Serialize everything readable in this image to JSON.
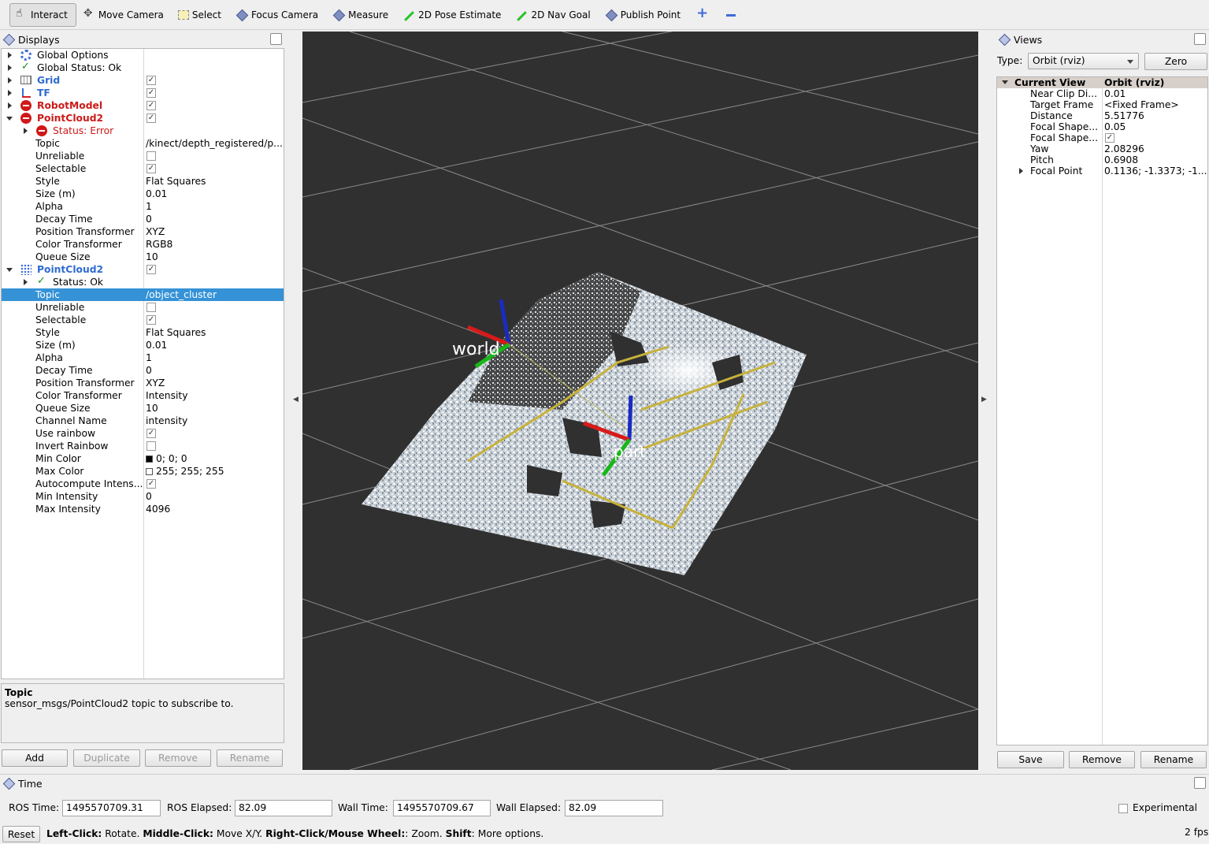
{
  "toolbar": {
    "interact": "Interact",
    "move_camera": "Move Camera",
    "select": "Select",
    "focus_camera": "Focus Camera",
    "measure": "Measure",
    "pose_estimate": "2D Pose Estimate",
    "nav_goal": "2D Nav Goal",
    "publish_point": "Publish Point"
  },
  "displays": {
    "title": "Displays",
    "rows": {
      "global_options": "Global Options",
      "global_status": "Global Status: Ok",
      "grid": "Grid",
      "tf": "TF",
      "robot_model": "RobotModel",
      "pc1": "PointCloud2",
      "pc1_status": "Status: Error",
      "pc2": "PointCloud2",
      "pc2_status": "Status: Ok"
    },
    "pc1_props": [
      {
        "k": "Topic",
        "v": "/kinect/depth_registered/p..."
      },
      {
        "k": "Unreliable",
        "v": ""
      },
      {
        "k": "Selectable",
        "v": ""
      },
      {
        "k": "Style",
        "v": "Flat Squares"
      },
      {
        "k": "Size (m)",
        "v": "0.01"
      },
      {
        "k": "Alpha",
        "v": "1"
      },
      {
        "k": "Decay Time",
        "v": "0"
      },
      {
        "k": "Position Transformer",
        "v": "XYZ"
      },
      {
        "k": "Color Transformer",
        "v": "RGB8"
      },
      {
        "k": "Queue Size",
        "v": "10"
      }
    ],
    "pc2_props": [
      {
        "k": "Topic",
        "v": "/object_cluster"
      },
      {
        "k": "Unreliable",
        "v": ""
      },
      {
        "k": "Selectable",
        "v": ""
      },
      {
        "k": "Style",
        "v": "Flat Squares"
      },
      {
        "k": "Size (m)",
        "v": "0.01"
      },
      {
        "k": "Alpha",
        "v": "1"
      },
      {
        "k": "Decay Time",
        "v": "0"
      },
      {
        "k": "Position Transformer",
        "v": "XYZ"
      },
      {
        "k": "Color Transformer",
        "v": "Intensity"
      },
      {
        "k": "Queue Size",
        "v": "10"
      },
      {
        "k": "Channel Name",
        "v": "intensity"
      },
      {
        "k": "Use rainbow",
        "v": ""
      },
      {
        "k": "Invert Rainbow",
        "v": ""
      },
      {
        "k": "Min Color",
        "v": "0; 0; 0"
      },
      {
        "k": "Max Color",
        "v": "255; 255; 255"
      },
      {
        "k": "Autocompute Intens...",
        "v": ""
      },
      {
        "k": "Min Intensity",
        "v": "0"
      },
      {
        "k": "Max Intensity",
        "v": "4096"
      }
    ],
    "desc_title": "Topic",
    "desc_text": "sensor_msgs/PointCloud2 topic to subscribe to.",
    "add": "Add",
    "duplicate": "Duplicate",
    "remove": "Remove",
    "rename": "Rename"
  },
  "scene": {
    "frame_world": "world",
    "frame_part": "part"
  },
  "views": {
    "title": "Views",
    "type_label": "Type:",
    "type_value": "Orbit (rviz)",
    "zero": "Zero",
    "header_k": "Current View",
    "header_v": "Orbit (rviz)",
    "props": [
      {
        "k": "Near Clip Di...",
        "v": "0.01"
      },
      {
        "k": "Target Frame",
        "v": "<Fixed Frame>"
      },
      {
        "k": "Distance",
        "v": "5.51776"
      },
      {
        "k": "Focal Shape...",
        "v": "0.05"
      },
      {
        "k": "Focal Shape...",
        "v": ""
      },
      {
        "k": "Yaw",
        "v": "2.08296"
      },
      {
        "k": "Pitch",
        "v": "0.6908"
      },
      {
        "k": "Focal Point",
        "v": "0.1136; -1.3373; -1..."
      }
    ],
    "save": "Save",
    "remove": "Remove",
    "rename": "Rename"
  },
  "time": {
    "title": "Time",
    "ros_time_label": "ROS Time:",
    "ros_time": "1495570709.31",
    "ros_elapsed_label": "ROS Elapsed:",
    "ros_elapsed": "82.09",
    "wall_time_label": "Wall Time:",
    "wall_time": "1495570709.67",
    "wall_elapsed_label": "Wall Elapsed:",
    "wall_elapsed": "82.09",
    "experimental": "Experimental",
    "reset": "Reset",
    "help_1": "Left-Click:",
    "help_2": " Rotate. ",
    "help_3": "Middle-Click:",
    "help_4": " Move X/Y. ",
    "help_5": "Right-Click/Mouse Wheel:",
    "help_6": ": Zoom. ",
    "help_7": "Shift",
    "help_8": ": More options.",
    "fps": "2 fps"
  }
}
